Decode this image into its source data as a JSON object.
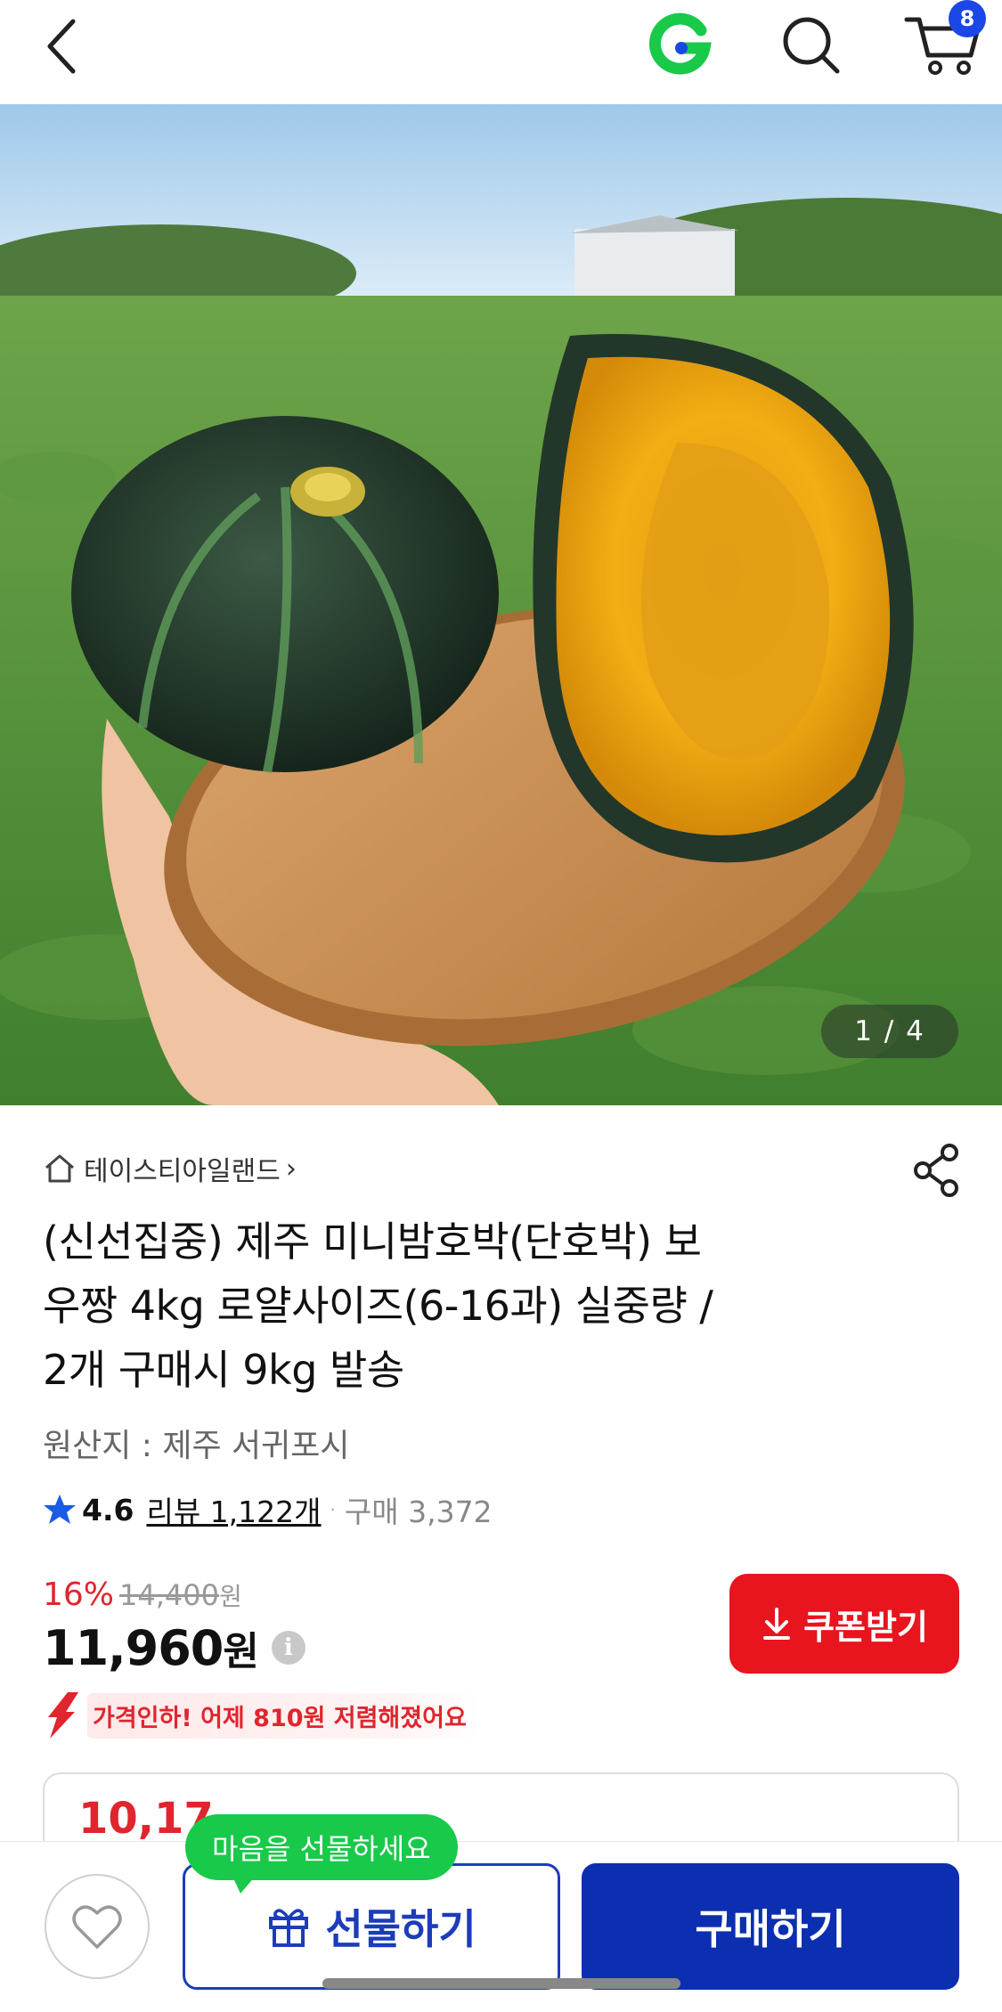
{
  "header": {
    "back_icon": "chevron-left-icon",
    "logo_icon": "g-logo-icon",
    "search_icon": "search-icon",
    "cart_icon": "cart-icon",
    "cart_count": "8",
    "logo_colors": {
      "green": "#19c94a",
      "blue": "#1a47e5"
    }
  },
  "hero": {
    "page_counter": "1 / 4"
  },
  "product": {
    "store_icon": "home-icon",
    "store_name": "테이스티아일랜드",
    "store_chevron": "›",
    "share_icon": "share-icon",
    "title_lines": [
      "(신선집중) 제주 미니밤호박(단호박) 보",
      "우짱 4kg 로얄사이즈(6-16과) 실중량 /",
      "2개 구매시 9kg 발송"
    ],
    "origin": "원산지 : 제주 서귀포시",
    "rating": "4.6",
    "review_label": "리뷰 1,122개",
    "separator": "·",
    "buy_count": "구매 3,372"
  },
  "price": {
    "discount_rate": "16%",
    "original_price": "14,400",
    "original_unit": "원",
    "sale_price": "11,960",
    "sale_unit": "원",
    "info_icon": "i",
    "coupon_label": "쿠폰받기",
    "price_drop_text": "가격인하! 어제 810원 저렴해졌어요",
    "card_price_partial": "10,17",
    "accent_red": "#e0252e",
    "brand_blue": "#0b2fb0"
  },
  "bottom": {
    "wish_icon": "heart-icon",
    "gift_icon": "gift-icon",
    "gift_label": "선물하기",
    "gift_bubble": "마음을 선물하세요",
    "buy_label": "구매하기"
  }
}
